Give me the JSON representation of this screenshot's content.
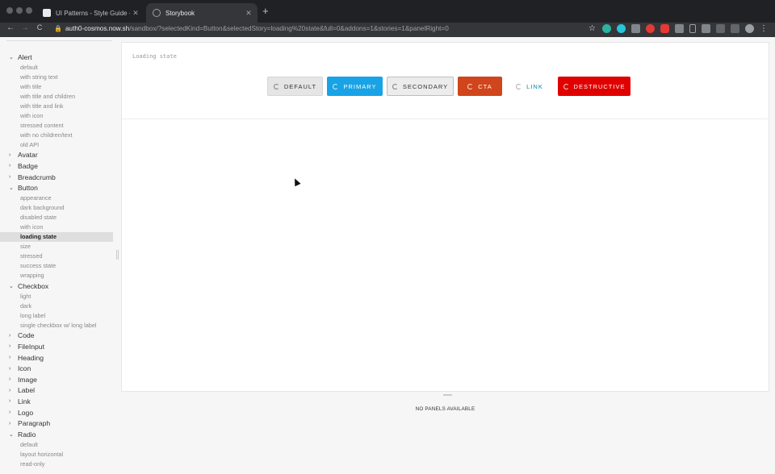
{
  "browser": {
    "tabs": [
      {
        "label": "UI Patterns - Style Guide - Brand",
        "close": "✕"
      },
      {
        "label": "Storybook",
        "close": "✕"
      }
    ],
    "new_tab": "+",
    "back": "←",
    "forward": "→",
    "reload": "C",
    "lock": "🔒",
    "url_host": "auth0-cosmos.now.sh",
    "url_path": "/sandbox/?selectedKind=Button&selectedStory=loading%20state&full=0&addons=1&stories=1&panelRight=0",
    "star": "☆",
    "menu": "⋮"
  },
  "sidebar": {
    "kinds": [
      {
        "label": "Alert",
        "caret": "⌄",
        "stories": [
          "default",
          "with string text",
          "with title",
          "with title and children",
          "with title and link",
          "with icon",
          "stressed content",
          "with no children/text",
          "old API"
        ]
      },
      {
        "label": "Avatar",
        "caret": "›",
        "stories": []
      },
      {
        "label": "Badge",
        "caret": "›",
        "stories": []
      },
      {
        "label": "Breadcrumb",
        "caret": "›",
        "stories": []
      },
      {
        "label": "Button",
        "caret": "⌄",
        "stories": [
          "appearance",
          "dark background",
          "disabled state",
          "with icon",
          "loading state",
          "size",
          "stressed",
          "success state",
          "wrapping"
        ]
      },
      {
        "label": "Checkbox",
        "caret": "⌄",
        "stories": [
          "light",
          "dark",
          "long label",
          "single checkbox w/ long label"
        ]
      },
      {
        "label": "Code",
        "caret": "›",
        "stories": []
      },
      {
        "label": "FileInput",
        "caret": "›",
        "stories": []
      },
      {
        "label": "Heading",
        "caret": "›",
        "stories": []
      },
      {
        "label": "Icon",
        "caret": "›",
        "stories": []
      },
      {
        "label": "Image",
        "caret": "›",
        "stories": []
      },
      {
        "label": "Label",
        "caret": "›",
        "stories": []
      },
      {
        "label": "Link",
        "caret": "›",
        "stories": []
      },
      {
        "label": "Logo",
        "caret": "›",
        "stories": []
      },
      {
        "label": "Paragraph",
        "caret": "›",
        "stories": []
      },
      {
        "label": "Radio",
        "caret": "⌄",
        "stories": [
          "default",
          "layout horizontal",
          "read-only"
        ]
      }
    ],
    "selected_story": "loading state"
  },
  "preview": {
    "story_title": "Loading state",
    "buttons": [
      {
        "label": "DEFAULT",
        "variant": "default"
      },
      {
        "label": "PRIMARY",
        "variant": "primary"
      },
      {
        "label": "SECONDARY",
        "variant": "secondary"
      },
      {
        "label": "CTA",
        "variant": "cta"
      },
      {
        "label": "LINK",
        "variant": "link"
      },
      {
        "label": "DESTRUCTIVE",
        "variant": "destructive"
      }
    ]
  },
  "addons_panel": {
    "empty_message": "NO PANELS AVAILABLE"
  },
  "colors": {
    "primary": "#18a3e6",
    "cta": "#d0451b",
    "destructive": "#e00000",
    "link": "#0a84ae"
  }
}
